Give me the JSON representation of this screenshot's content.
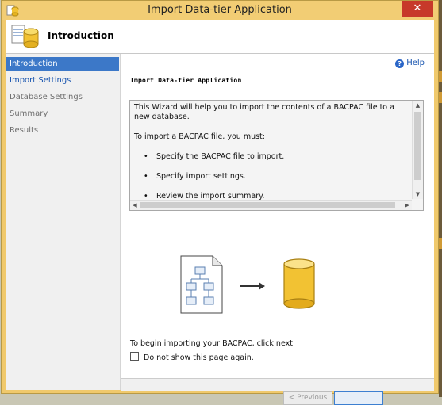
{
  "window": {
    "title": "Import Data-tier Application"
  },
  "header": {
    "title": "Introduction"
  },
  "sidebar": {
    "items": [
      {
        "label": "Introduction"
      },
      {
        "label": "Import Settings"
      },
      {
        "label": "Database Settings"
      },
      {
        "label": "Summary"
      },
      {
        "label": "Results"
      }
    ]
  },
  "main": {
    "help_label": "Help",
    "section_title": "Import Data-tier Application",
    "intro_text": "This Wizard will help you to import the contents of a BACPAC file to a new database.",
    "steps_heading": "To import a BACPAC file, you must:",
    "steps": [
      "Specify the BACPAC file to import.",
      "Specify import settings.",
      "Review the import summary."
    ],
    "begin_text": "To begin importing your BACPAC, click next.",
    "checkbox_label": "Do not show this page again."
  },
  "buttons": {
    "previous": "< Previous"
  },
  "colors": {
    "selected_nav": "#3c78c8",
    "window_frame": "#f0c96c",
    "link": "#1a56b0"
  },
  "icons": [
    "application-icon",
    "close-icon",
    "wizard-database-icon",
    "help-icon",
    "bacpac-file-icon",
    "arrow-right-icon",
    "database-icon"
  ]
}
